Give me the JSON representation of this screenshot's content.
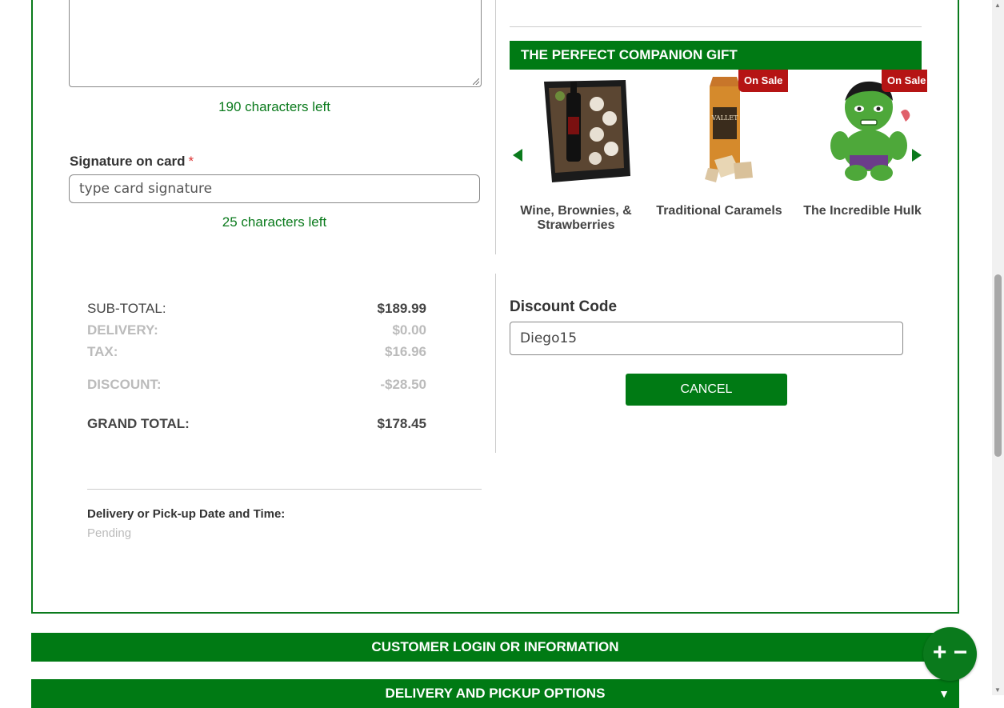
{
  "message": {
    "chars_left": "190 characters left"
  },
  "signature": {
    "label": "Signature on card",
    "required_mark": "*",
    "placeholder": "type card signature",
    "chars_left": "25 characters left"
  },
  "companion": {
    "header": "THE PERFECT COMPANION GIFT",
    "products": [
      {
        "name": "Wine, Brownies, & Strawberries",
        "badge": ""
      },
      {
        "name": "Traditional Caramels",
        "badge": "On Sale"
      },
      {
        "name": "The Incredible Hulk",
        "badge": "On Sale"
      }
    ],
    "caramel_brand": "VALLET"
  },
  "totals": {
    "subtotal_label": "SUB-TOTAL:",
    "subtotal_value": "$189.99",
    "delivery_label": "DELIVERY:",
    "delivery_value": "$0.00",
    "tax_label": "TAX:",
    "tax_value": "$16.96",
    "discount_label": "DISCOUNT:",
    "discount_value": "-$28.50",
    "grand_label": "GRAND TOTAL:",
    "grand_value": "$178.45"
  },
  "delivery_time": {
    "label": "Delivery or Pick-up Date and Time:",
    "value": "Pending"
  },
  "discount": {
    "label": "Discount Code",
    "value": "Diego15",
    "cancel_label": "CANCEL"
  },
  "sections": {
    "customer_login": "CUSTOMER LOGIN OR INFORMATION",
    "delivery_options": "DELIVERY AND PICKUP OPTIONS"
  },
  "zoom": {
    "label": "+ −"
  },
  "colors": {
    "brand_green": "#007a14",
    "sale_red": "#b51414"
  }
}
